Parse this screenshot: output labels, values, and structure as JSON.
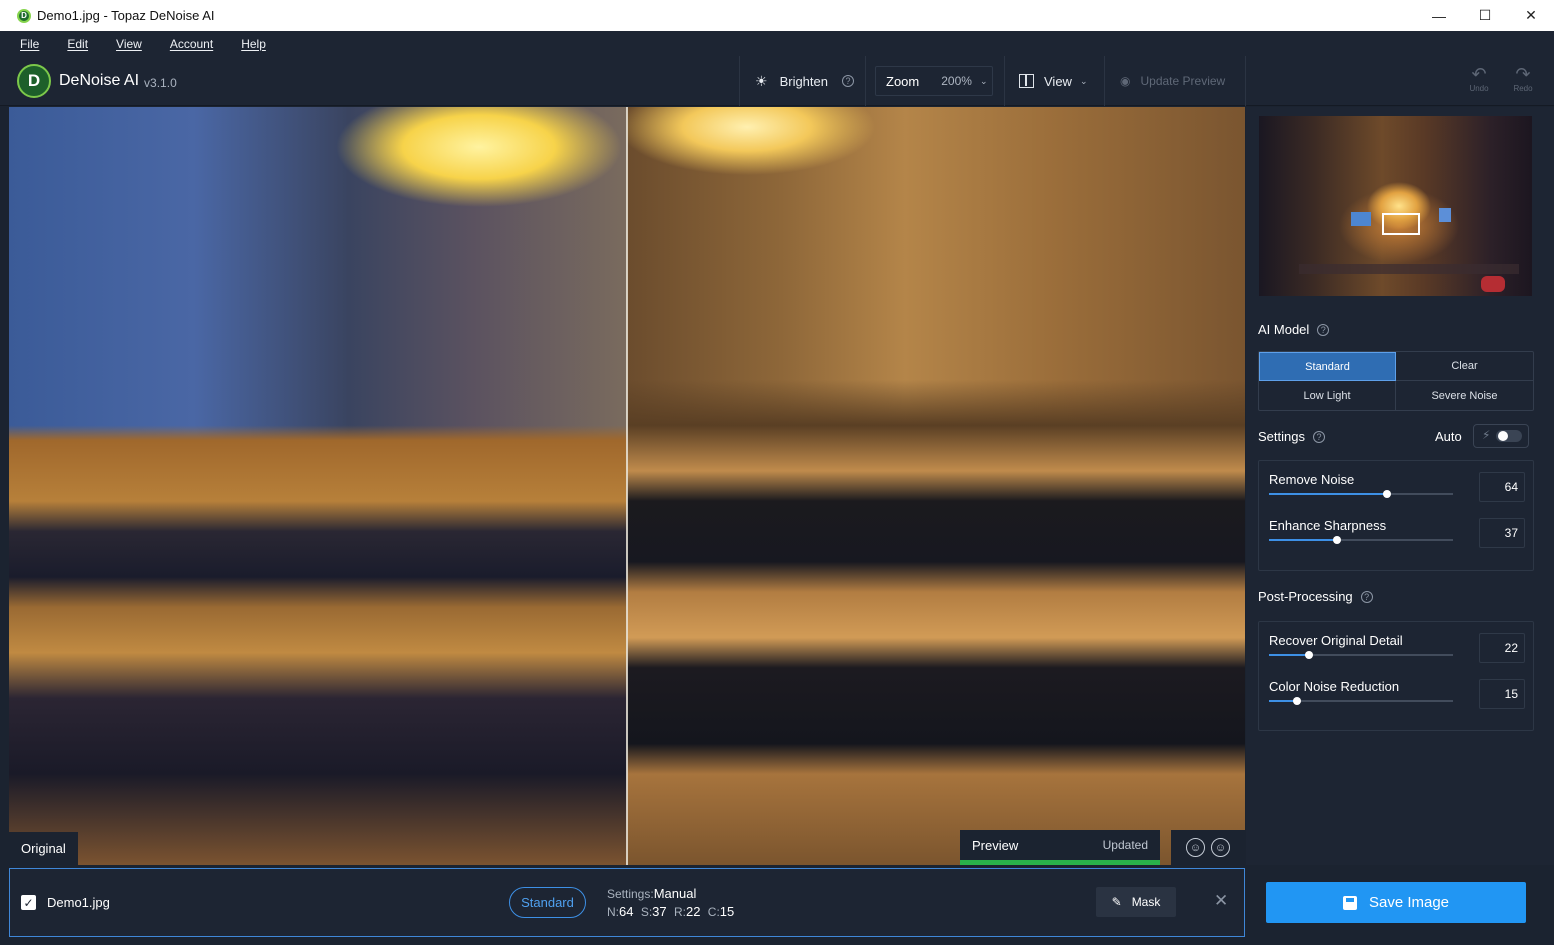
{
  "window": {
    "title": "Demo1.jpg - Topaz DeNoise AI",
    "min": "—",
    "max": "☐",
    "close": "✕"
  },
  "menu": [
    "File",
    "Edit",
    "View",
    "Account",
    "Help"
  ],
  "brand": {
    "name": "DeNoise AI",
    "version": "v3.1.0",
    "logo_letter": "D"
  },
  "toolbar": {
    "brighten": "Brighten",
    "zoom_label": "Zoom",
    "zoom_value": "200%",
    "view": "View",
    "update_preview": "Update Preview",
    "undo": "Undo",
    "redo": "Redo"
  },
  "viewer": {
    "left_label": "Original",
    "preview_label": "Preview",
    "preview_status": "Updated",
    "preview_bar_color": "#29b24a"
  },
  "panel": {
    "ai_model_title": "AI Model",
    "models": [
      "Standard",
      "Clear",
      "Low Light",
      "Severe Noise"
    ],
    "selected_model": "Standard",
    "settings_title": "Settings",
    "auto_label": "Auto",
    "auto_enabled": false,
    "settings": [
      {
        "name": "Remove Noise",
        "value": "64"
      },
      {
        "name": "Enhance Sharpness",
        "value": "37"
      }
    ],
    "post_title": "Post-Processing",
    "post": [
      {
        "name": "Recover Original Detail",
        "value": "22"
      },
      {
        "name": "Color Noise Reduction",
        "value": "15"
      }
    ]
  },
  "file": {
    "name": "Demo1.jpg",
    "checked": true,
    "model_pill": "Standard",
    "settings_key": "Settings:",
    "settings_val": "Manual",
    "n_key": "N:",
    "n_val": "64",
    "s_key": "S:",
    "s_val": "37",
    "r_key": "R:",
    "r_val": "22",
    "c_key": "C:",
    "c_val": "15",
    "mask": "Mask"
  },
  "save": "Save Image",
  "colors": {
    "accent": "#2196f3",
    "model_active": "#2f6db3",
    "bg": "#1b2330"
  }
}
